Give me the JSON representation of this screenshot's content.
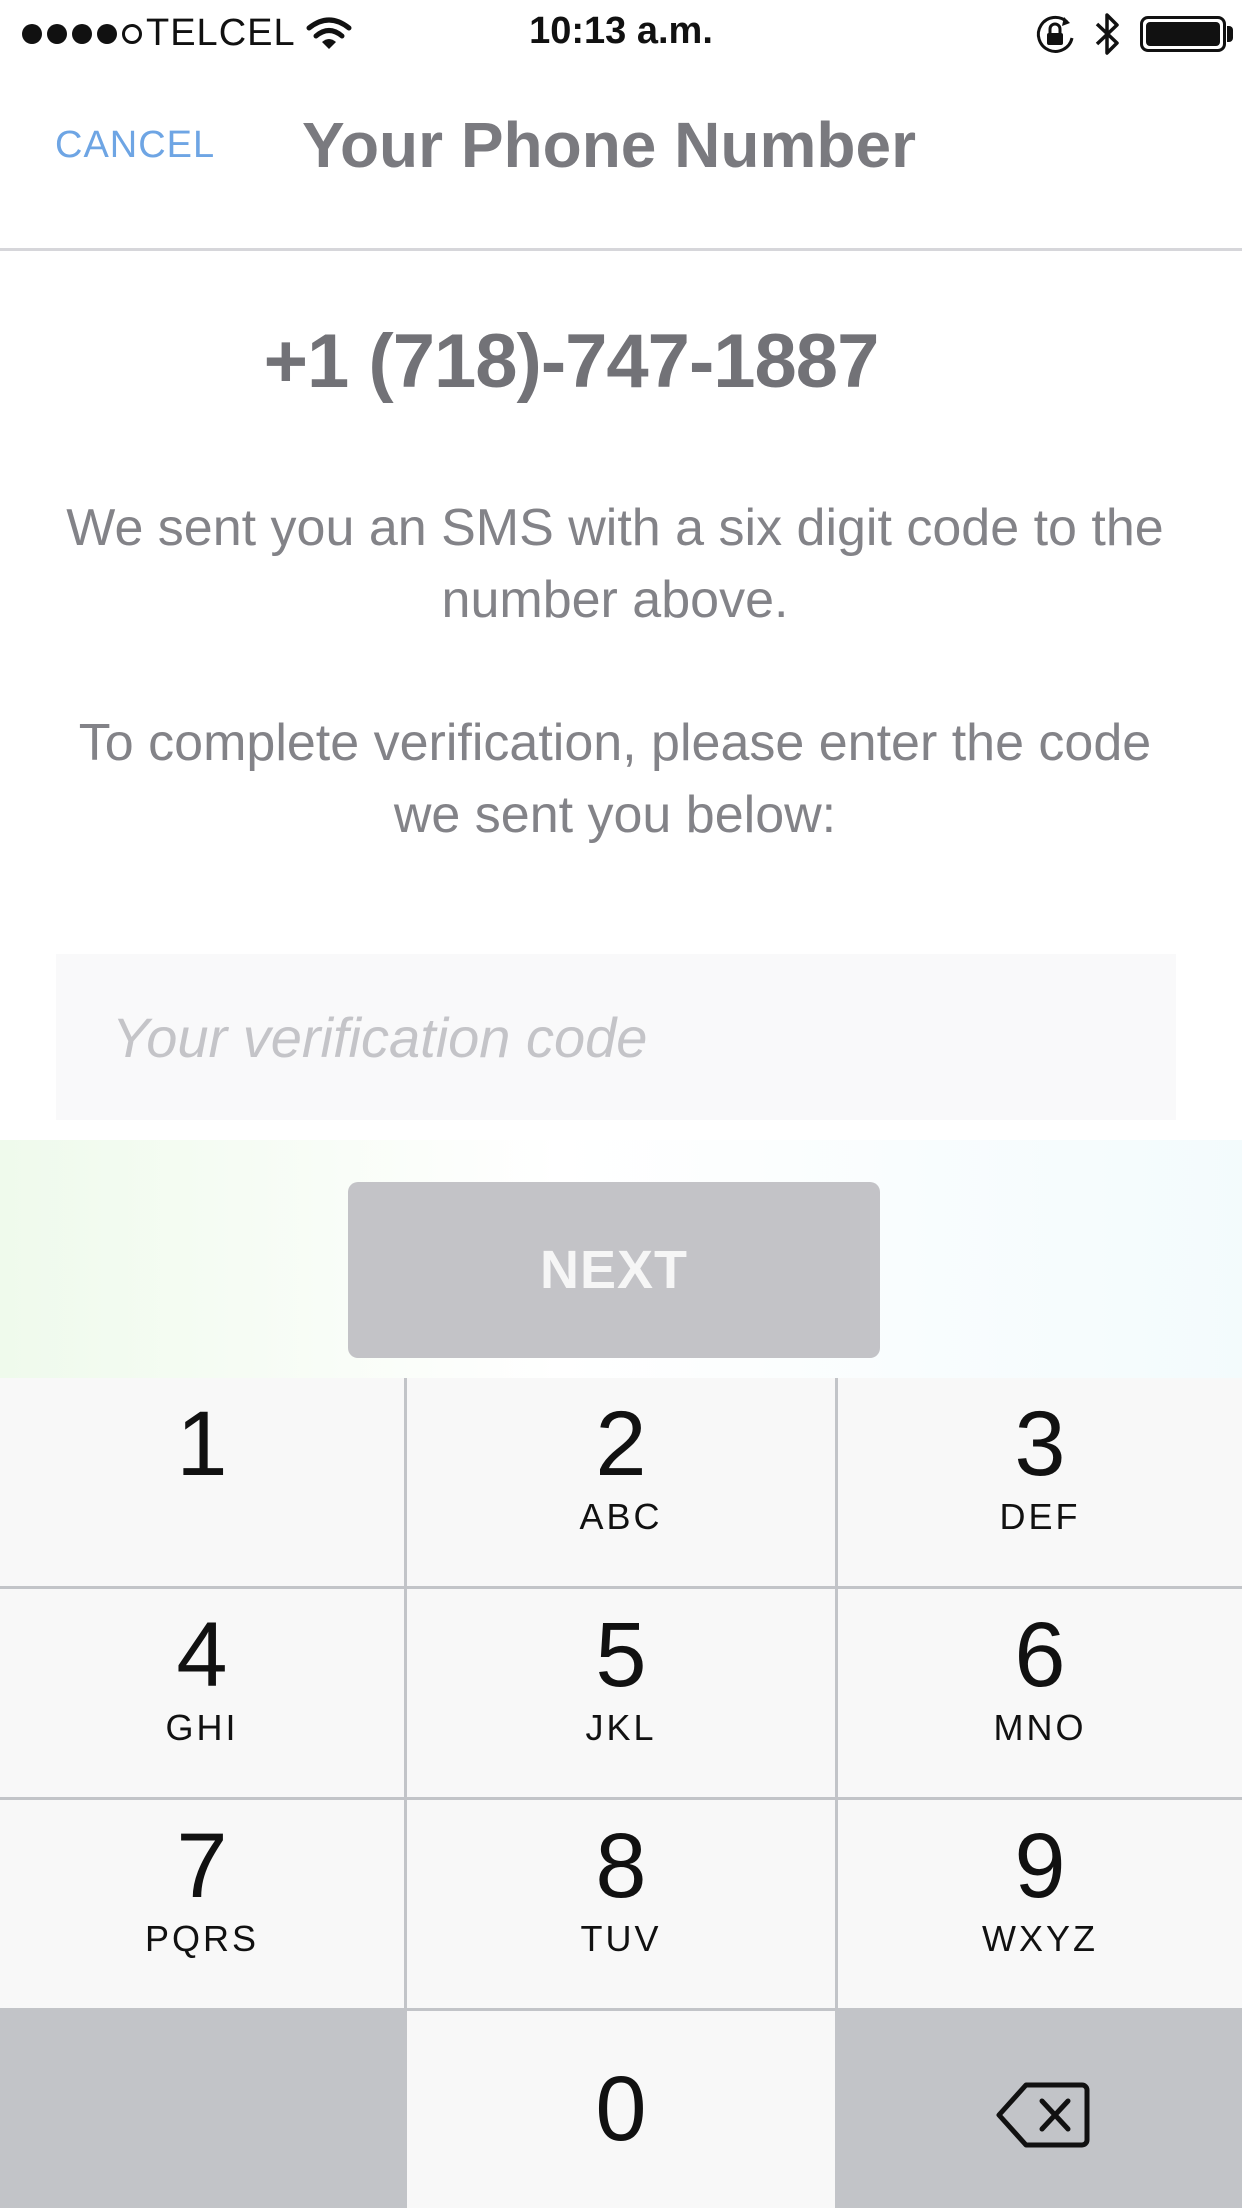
{
  "status_bar": {
    "carrier": "TELCEL",
    "time": "10:13 a.m.",
    "signal_bars_filled": 4,
    "signal_bars_total": 5,
    "icons": [
      "wifi-icon",
      "rotation-lock-icon",
      "bluetooth-icon",
      "battery-icon"
    ],
    "battery_level": 1.0
  },
  "nav": {
    "cancel_label": "CANCEL",
    "title": "Your Phone Number"
  },
  "content": {
    "phone_number": "+1 (718)-747-1887",
    "message_line1": "We sent you an SMS with a six digit code to the number above.",
    "message_line2": "To complete verification, please enter the code we sent you below:",
    "code_placeholder": "Your verification code",
    "code_value": "",
    "next_label": "NEXT"
  },
  "keypad": {
    "keys": [
      {
        "num": "1",
        "letters": ""
      },
      {
        "num": "2",
        "letters": "ABC"
      },
      {
        "num": "3",
        "letters": "DEF"
      },
      {
        "num": "4",
        "letters": "GHI"
      },
      {
        "num": "5",
        "letters": "JKL"
      },
      {
        "num": "6",
        "letters": "MNO"
      },
      {
        "num": "7",
        "letters": "PQRS"
      },
      {
        "num": "8",
        "letters": "TUV"
      },
      {
        "num": "9",
        "letters": "WXYZ"
      },
      {
        "num": "0",
        "letters": ""
      }
    ],
    "delete_icon": "delete-icon"
  },
  "colors": {
    "accent": "#6ea5e4",
    "button_disabled": "#c3c3c7",
    "keypad_background": "#c2c4c8"
  }
}
